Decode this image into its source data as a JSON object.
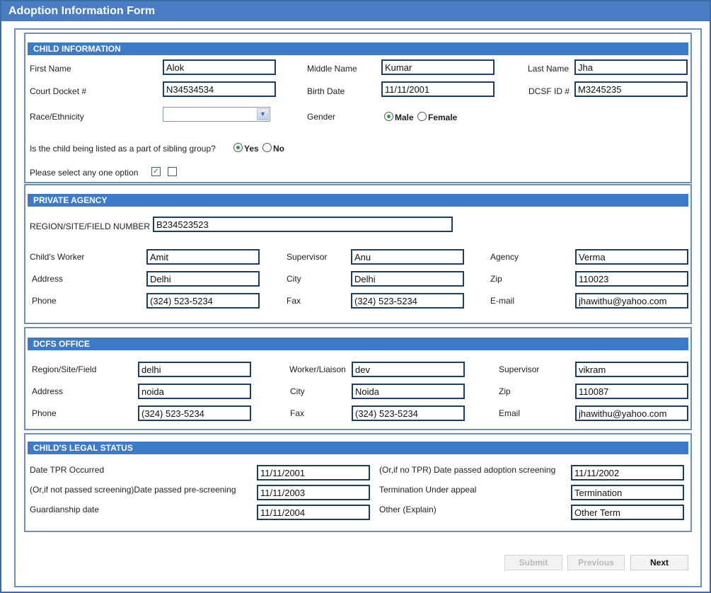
{
  "window": {
    "title": "Adoption Information Form"
  },
  "child_info": {
    "heading": "CHILD INFORMATION",
    "first_name_label": "First Name",
    "first_name": "Alok",
    "middle_name_label": "Middle Name",
    "middle_name": "Kumar",
    "last_name_label": "Last Name",
    "last_name": "Jha",
    "court_docket_label": "Court Docket #",
    "court_docket": "N34534534",
    "birth_date_label": "Birth Date",
    "birth_date": "11/11/2001",
    "dcsf_id_label": "DCSF ID #",
    "dcsf_id": "M3245235",
    "race_label": "Race/Ethnicity",
    "race_value": "",
    "gender_label": "Gender",
    "gender_male": "Male",
    "gender_female": "Female",
    "gender_selected": "Male",
    "sibling_question": "Is the child being listed as a part of sibling group?",
    "sibling_yes": "Yes",
    "sibling_no": "No",
    "sibling_selected": "Yes",
    "select_option_label": "Please select any one option",
    "checkbox1_checked": true,
    "checkbox2_checked": false
  },
  "private_agency": {
    "heading": "PRIVATE AGENCY",
    "region_label": "REGION/SITE/FIELD NUMBER",
    "region": "B234523523",
    "worker_label": "Child's Worker",
    "worker": "Amit",
    "supervisor_label": "Supervisor",
    "supervisor": "Anu",
    "agency_label": "Agency",
    "agency": "Verma",
    "address_label": "Address",
    "address": "Delhi",
    "city_label": "City",
    "city": "Delhi",
    "zip_label": "Zip",
    "zip": "110023",
    "phone_label": "Phone",
    "phone": "(324) 523-5234",
    "fax_label": "Fax",
    "fax": "(324) 523-5234",
    "email_label": "E-mail",
    "email": "jhawithu@yahoo.com"
  },
  "dcfs_office": {
    "heading": "DCFS OFFICE",
    "region_label": "Region/Site/Field",
    "region": "delhi",
    "worker_label": "Worker/Liaison",
    "worker": "dev",
    "supervisor_label": "Supervisor",
    "supervisor": "vikram",
    "address_label": "Address",
    "address": "noida",
    "city_label": "City",
    "city": "Noida",
    "zip_label": "Zip",
    "zip": "110087",
    "phone_label": "Phone",
    "phone": "(324) 523-5234",
    "fax_label": "Fax",
    "fax": "(324) 523-5234",
    "email_label": "Email",
    "email": "jhawithu@yahoo.com"
  },
  "legal_status": {
    "heading": "CHILD'S LEGAL STATUS",
    "tpr_label": "Date TPR Occurred",
    "tpr": "11/11/2001",
    "adoption_screening_label": "(Or,if no TPR) Date passed adoption screening",
    "adoption_screening": "11/11/2002",
    "pre_screening_label": "(Or,if not passed screening)Date passed pre-screening",
    "pre_screening": "11/11/2003",
    "termination_label": "Termination Under appeal",
    "termination": "Termination",
    "guardianship_label": "Guardianship date",
    "guardianship": "11/11/2004",
    "other_label": "Other (Explain)",
    "other": "Other Term"
  },
  "buttons": {
    "submit": "Submit",
    "previous": "Previous",
    "next": "Next"
  },
  "colors": {
    "header_blue": "#3d7ac9",
    "title_blue": "#4a7cc4",
    "border_blue": "#6b8fbf"
  }
}
